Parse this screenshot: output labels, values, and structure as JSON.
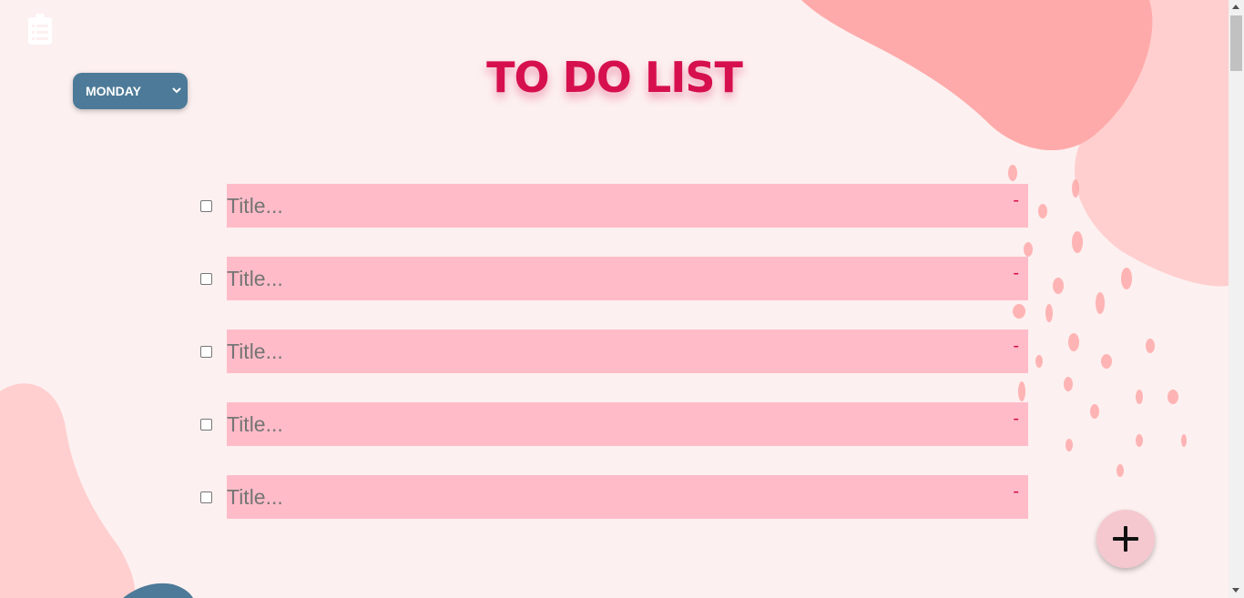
{
  "app": {
    "icon": "clipboard-list-icon"
  },
  "day_select": {
    "selected": "MONDAY",
    "icon": "chevron-down-icon"
  },
  "title": "TO DO LIST",
  "tasks": [
    {
      "placeholder": "Title...",
      "remove_label": "-",
      "checked": false
    },
    {
      "placeholder": "Title...",
      "remove_label": "-",
      "checked": false
    },
    {
      "placeholder": "Title...",
      "remove_label": "-",
      "checked": false
    },
    {
      "placeholder": "Title...",
      "remove_label": "-",
      "checked": false
    },
    {
      "placeholder": "Title...",
      "remove_label": "-",
      "checked": false
    }
  ],
  "add_button": {
    "icon": "plus-icon"
  },
  "colors": {
    "background": "#fdf0f0",
    "accent": "#d6104f",
    "task_fill": "#ffbcc8",
    "select_bg": "#4c7a98",
    "blob_dark": "#ffaaaa",
    "blob_light": "#ffcfcf"
  }
}
